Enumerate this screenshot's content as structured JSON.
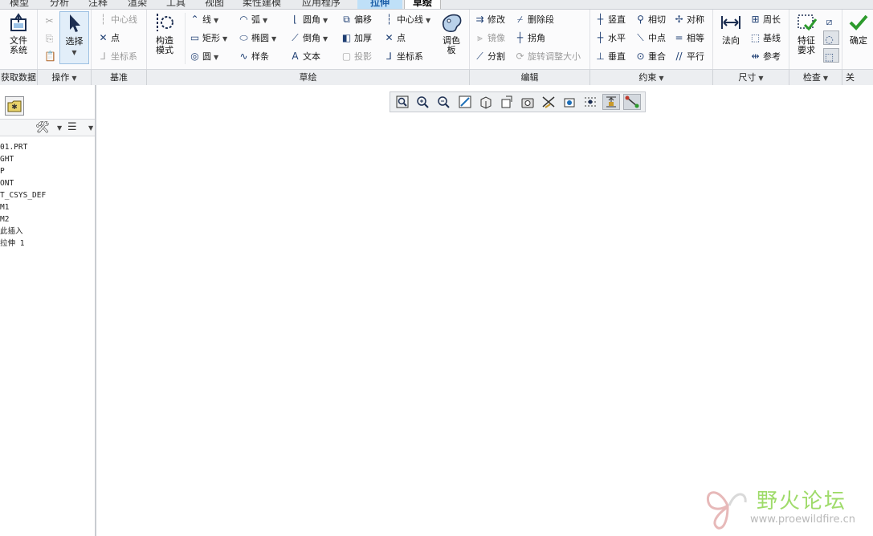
{
  "tabs": [
    {
      "label": "模型"
    },
    {
      "label": "分析"
    },
    {
      "label": "注释"
    },
    {
      "label": "渲染"
    },
    {
      "label": "工具"
    },
    {
      "label": "视图"
    },
    {
      "label": "柔性建模"
    },
    {
      "label": "应用程序"
    },
    {
      "label": "拉伸"
    },
    {
      "label": "草绘"
    }
  ],
  "ribbon": {
    "file_system": "文件\n系统",
    "select": "选择",
    "construct_mode": "构造\n模式",
    "palette": "调色\n板",
    "normal": "法向",
    "feature_req": "特征\n要求",
    "confirm": "确定",
    "datum": {
      "centerline": "中心线",
      "point": "点",
      "csys": "坐标系"
    },
    "sketch": {
      "line": "线",
      "arc": "弧",
      "fillet": "圆角",
      "offset": "偏移",
      "centerline": "中心线",
      "rect": "矩形",
      "ellipse": "椭圆",
      "chamfer": "倒角",
      "thicken": "加厚",
      "point": "点",
      "circle": "圆",
      "spline": "样条",
      "text": "文本",
      "project": "投影",
      "csys": "坐标系"
    },
    "edit": {
      "modify": "修改",
      "delete_seg": "删除段",
      "mirror": "镜像",
      "corner": "拐角",
      "divide": "分割",
      "rotate_resize": "旋转调整大小"
    },
    "constrain": {
      "vertical": "竖直",
      "tangent": "相切",
      "symmetric": "对称",
      "horizontal": "水平",
      "midpoint": "中点",
      "equal": "相等",
      "perpendicular": "垂直",
      "coincident": "重合",
      "parallel": "平行"
    },
    "dimension": {
      "perimeter": "周长",
      "baseline": "基线",
      "reference": "参考"
    },
    "groups": {
      "get_data": "获取数据",
      "operations": "操作",
      "datum": "基准",
      "sketch": "草绘",
      "edit": "编辑",
      "constrain": "约束",
      "dimension": "尺寸",
      "inspect": "检查",
      "close": "关"
    }
  },
  "model_tree": {
    "items": [
      "01.PRT",
      "GHT",
      "P",
      "ONT",
      "T_CSYS_DEF",
      "M1",
      "M2",
      "此插入",
      "拉伸 1"
    ]
  },
  "watermark": {
    "title": "野火论坛",
    "url": "www.proewildfire.cn"
  },
  "colors": {
    "accent": "#1c5fa8",
    "active_tab_bg": "#bfe0f8",
    "watermark": "#9fdb6a"
  }
}
